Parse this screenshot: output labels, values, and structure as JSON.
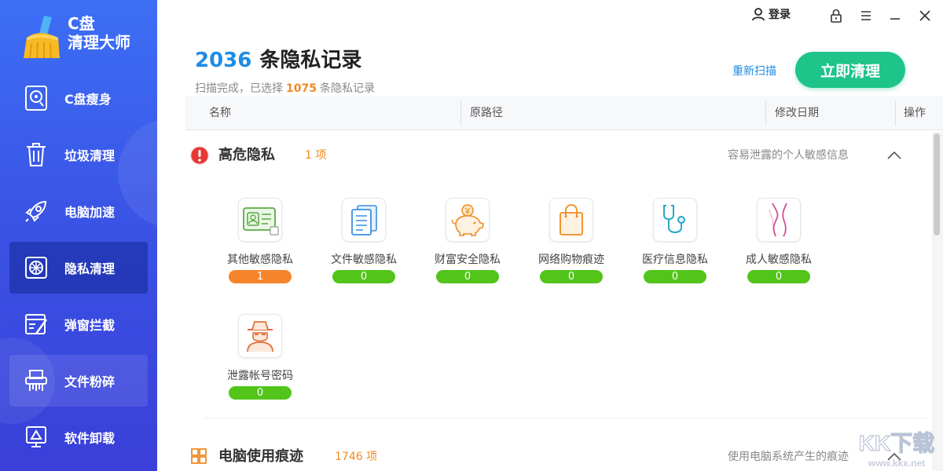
{
  "app": {
    "logo_line1": "C盘",
    "logo_line2": "清理大师"
  },
  "nav": {
    "items": [
      {
        "label": "C盘瘦身"
      },
      {
        "label": "垃圾清理"
      },
      {
        "label": "电脑加速"
      },
      {
        "label": "隐私清理"
      },
      {
        "label": "弹窗拦截"
      },
      {
        "label": "文件粉碎"
      },
      {
        "label": "软件卸载"
      }
    ]
  },
  "topbar": {
    "login_label": "登录"
  },
  "header": {
    "count": "2036",
    "title": "条隐私记录",
    "subtitle_prefix": "扫描完成，已选择",
    "selected_count": "1075",
    "subtitle_suffix": "条隐私记录",
    "rescan_label": "重新扫描",
    "clean_label": "立即清理"
  },
  "table": {
    "columns": [
      "名称",
      "原路径",
      "修改日期",
      "操作"
    ]
  },
  "sections": [
    {
      "title": "高危隐私",
      "count": "1 项",
      "desc": "容易泄露的个人敏感信息",
      "items": [
        {
          "label": "其他敏感隐私",
          "count": "1",
          "status": "warn"
        },
        {
          "label": "文件敏感隐私",
          "count": "0",
          "status": "ok"
        },
        {
          "label": "财富安全隐私",
          "count": "0",
          "status": "ok"
        },
        {
          "label": "网络购物痕迹",
          "count": "0",
          "status": "ok"
        },
        {
          "label": "医疗信息隐私",
          "count": "0",
          "status": "ok"
        },
        {
          "label": "成人敏感隐私",
          "count": "0",
          "status": "ok"
        },
        {
          "label": "泄露帐号密码",
          "count": "0",
          "status": "ok"
        }
      ]
    },
    {
      "title": "电脑使用痕迹",
      "count": "1746 项",
      "desc": "使用电脑系统产生的痕迹"
    }
  ],
  "colors": {
    "accent_blue": "#1f8ce6",
    "clean_green": "#1ec48a",
    "badge_ok": "#52c41a",
    "badge_warn": "#f5842b",
    "danger_red": "#e53935",
    "sidebar_blue": "#3a54e6"
  },
  "watermark": {
    "text": "KK下载",
    "url": "www.kkx.net"
  }
}
